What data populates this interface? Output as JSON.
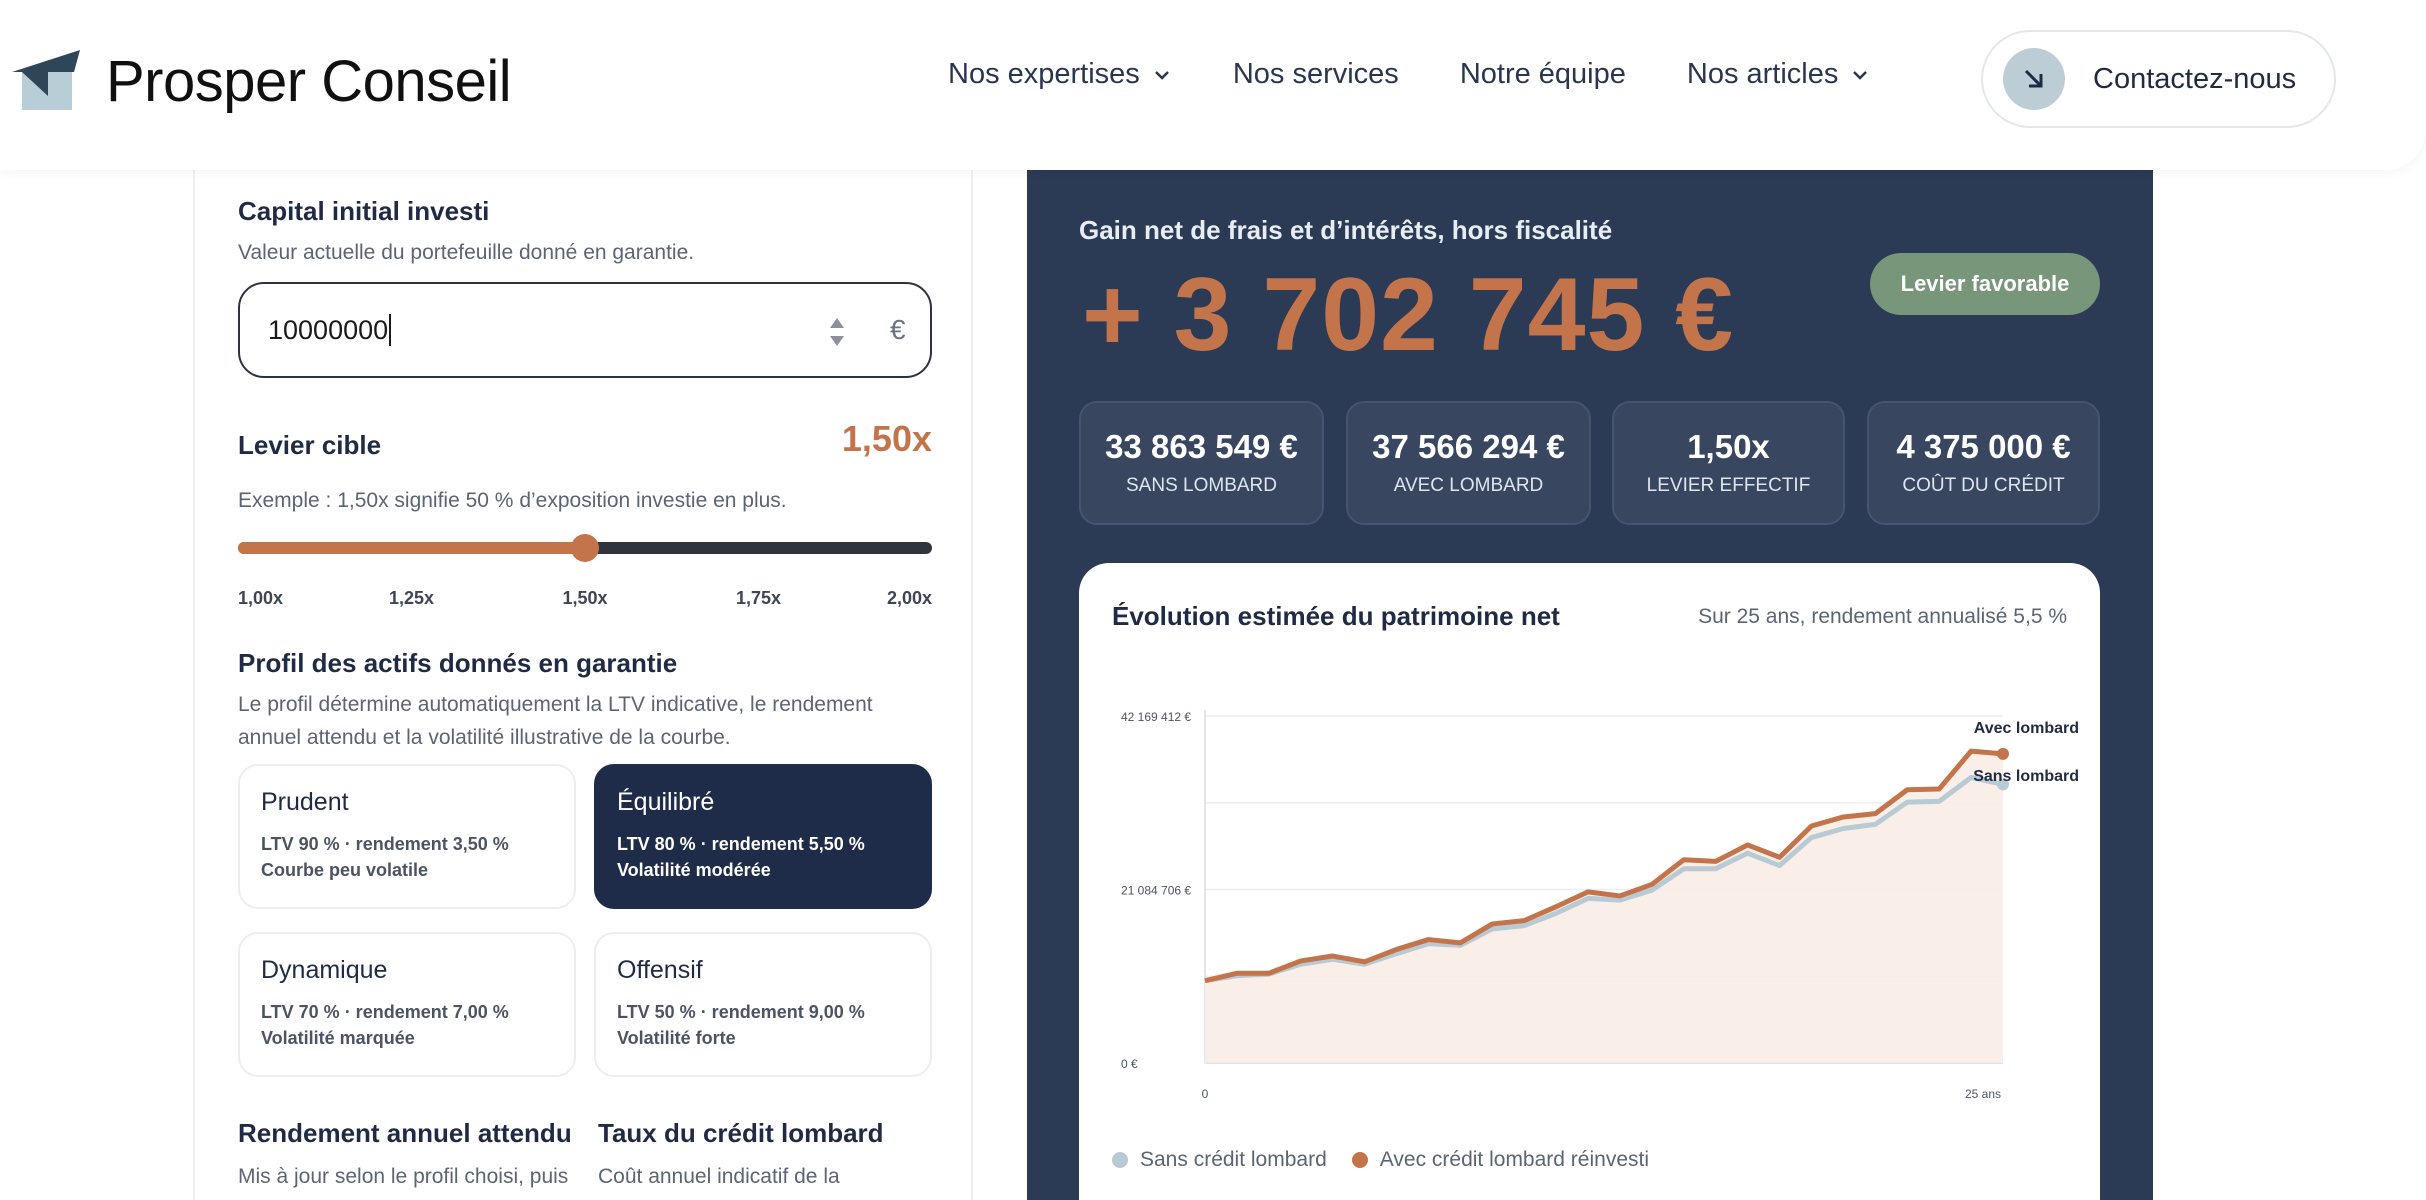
{
  "brand": {
    "name": "Prosper Conseil",
    "logo_icon": "paper-plane-logo"
  },
  "nav": {
    "items": [
      {
        "label": "Nos expertises",
        "dropdown": true
      },
      {
        "label": "Nos services",
        "dropdown": false
      },
      {
        "label": "Notre équipe",
        "dropdown": false
      },
      {
        "label": "Nos articles",
        "dropdown": true
      }
    ],
    "contact_label": "Contactez-nous",
    "contact_icon": "arrow-down-right-icon"
  },
  "form": {
    "capital": {
      "title": "Capital initial investi",
      "subtitle": "Valeur actuelle du portefeuille donné en garantie.",
      "value": "10000000",
      "currency": "€"
    },
    "leverage": {
      "title": "Levier cible",
      "value_label": "1,50x",
      "hint": "Exemple : 1,50x signifie 50 % d’exposition investie en plus.",
      "min": 1.0,
      "max": 2.0,
      "value": 1.5,
      "ticks": [
        "1,00x",
        "1,25x",
        "1,50x",
        "1,75x",
        "2,00x"
      ]
    },
    "profile": {
      "title": "Profil des actifs donnés en garantie",
      "description": "Le profil détermine automatiquement la LTV indicative, le rendement annuel attendu et la volatilité illustrative de la courbe.",
      "options": [
        {
          "name": "Prudent",
          "line1": "LTV 90 % · rendement 3,50 %",
          "line2": "Courbe peu volatile",
          "selected": false
        },
        {
          "name": "Équilibré",
          "line1": "LTV 80 % · rendement 5,50 %",
          "line2": "Volatilité modérée",
          "selected": true
        },
        {
          "name": "Dynamique",
          "line1": "LTV 70 % · rendement 7,00 %",
          "line2": "Volatilité marquée",
          "selected": false
        },
        {
          "name": "Offensif",
          "line1": "LTV 50 % · rendement 9,00 %",
          "line2": "Volatilité forte",
          "selected": false
        }
      ]
    },
    "return": {
      "title": "Rendement annuel attendu",
      "subtitle": "Mis à jour selon le profil choisi, puis"
    },
    "rate": {
      "title": "Taux du crédit lombard",
      "subtitle": "Coût annuel indicatif de la"
    }
  },
  "results": {
    "heading": "Gain net de frais et d’intérêts, hors fiscalité",
    "gain": "+ 3 702 745 €",
    "badge": "Levier favorable",
    "stats": [
      {
        "value": "33 863 549 €",
        "label": "Sans lombard"
      },
      {
        "value": "37 566 294 €",
        "label": "Avec lombard"
      },
      {
        "value": "1,50x",
        "label": "Levier effectif"
      },
      {
        "value": "4 375 000 €",
        "label": "Coût du crédit"
      }
    ],
    "colors": {
      "accent": "#c4744a",
      "panel": "#2b3a55",
      "badge": "#789679",
      "sans": "#b8cad3"
    }
  },
  "chart": {
    "title": "Évolution estimée du patrimoine net",
    "note": "Sur 25 ans, rendement annualisé 5,5 %",
    "legend": [
      "Sans crédit lombard",
      "Avec crédit lombard réinvesti"
    ],
    "end_labels": [
      "Avec lombard",
      "Sans lombard"
    ]
  },
  "chart_data": {
    "type": "line",
    "x": [
      0,
      1,
      2,
      3,
      4,
      5,
      6,
      7,
      8,
      9,
      10,
      11,
      12,
      13,
      14,
      15,
      16,
      17,
      18,
      19,
      20,
      21,
      22,
      23,
      24,
      25
    ],
    "x_tick_labels": [
      "0",
      "25 ans"
    ],
    "y_tick_labels": [
      "42 169 412 €",
      "21 084 706 €",
      "0 €"
    ],
    "ylim": [
      0,
      42169412
    ],
    "series": [
      {
        "name": "Sans crédit lombard",
        "values": [
          10000000,
          10600000,
          10800000,
          12000000,
          12600000,
          12000000,
          13300000,
          14500000,
          14300000,
          16300000,
          16700000,
          18200000,
          20000000,
          19800000,
          21000000,
          23600000,
          23600000,
          25500000,
          24000000,
          27400000,
          28500000,
          29000000,
          31700000,
          31800000,
          34700000,
          33863549
        ]
      },
      {
        "name": "Avec crédit lombard réinvesti",
        "values": [
          10000000,
          10900000,
          10900000,
          12400000,
          13000000,
          12300000,
          13800000,
          15000000,
          14600000,
          16900000,
          17300000,
          19000000,
          20800000,
          20300000,
          21700000,
          24700000,
          24500000,
          26500000,
          25000000,
          28800000,
          29900000,
          30300000,
          33200000,
          33300000,
          37900000,
          37566294
        ]
      }
    ]
  }
}
